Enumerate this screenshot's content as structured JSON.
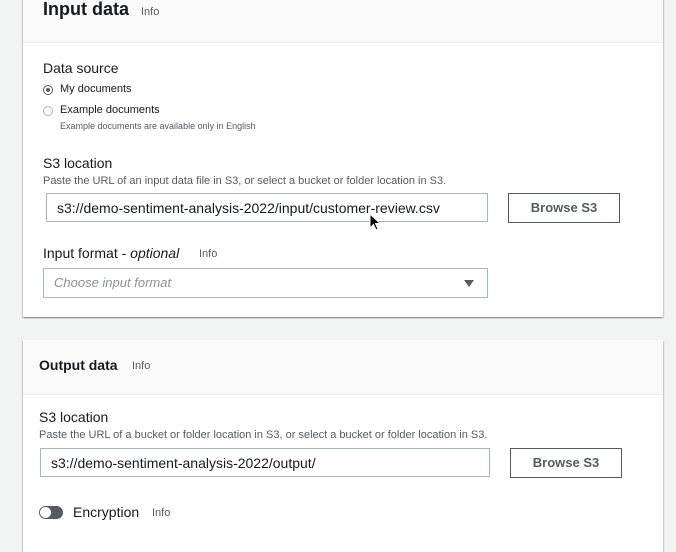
{
  "input_panel": {
    "title": "Input data",
    "info": "Info",
    "data_source": {
      "label": "Data source",
      "options": [
        {
          "label": "My documents",
          "selected": true
        },
        {
          "label": "Example documents",
          "selected": false,
          "description": "Example documents are available only in English"
        }
      ]
    },
    "s3": {
      "label": "S3 location",
      "description": "Paste the URL of an input data file in S3, or select a bucket or folder location in S3.",
      "value": "s3://demo-sentiment-analysis-2022/input/customer-review.csv",
      "browse_label": "Browse S3"
    },
    "format": {
      "label": "Input format - ",
      "label_optional": "optional",
      "info": "Info",
      "placeholder": "Choose input format"
    }
  },
  "output_panel": {
    "title": "Output data",
    "info": "Info",
    "s3": {
      "label": "S3 location",
      "description": "Paste the URL of a bucket or folder location in S3, or select a bucket or folder location in S3.",
      "value": "s3://demo-sentiment-analysis-2022/output/",
      "browse_label": "Browse S3"
    },
    "encryption": {
      "label": "Encryption",
      "info": "Info",
      "enabled": false
    }
  },
  "colors": {
    "background": "#f2f3f3",
    "panel": "#ffffff",
    "header": "#fafafa",
    "text": "#16191f",
    "secondary_text": "#545b64",
    "border": "#aab7b8"
  }
}
